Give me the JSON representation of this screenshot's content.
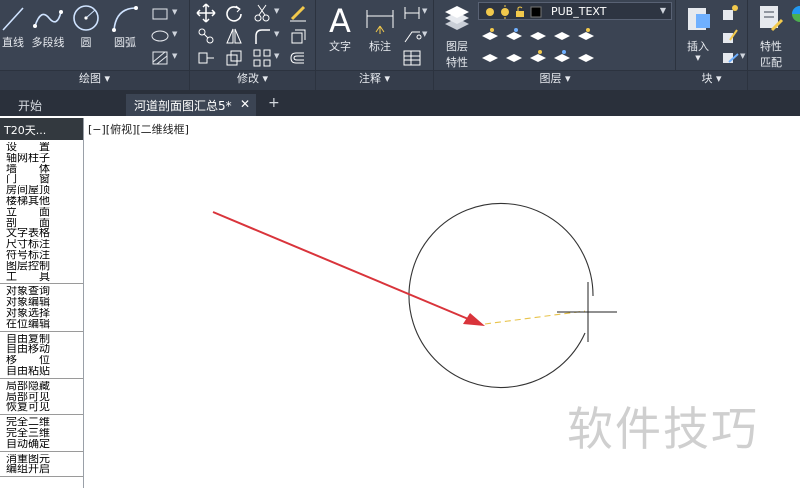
{
  "ribbon": {
    "draw": {
      "title": "绘图",
      "line_label": "直线",
      "polyline_label": "多段线",
      "circle_label": "圆",
      "arc_label": "圆弧"
    },
    "modify": {
      "title": "修改"
    },
    "annotation": {
      "title": "注释",
      "text_label": "文字",
      "dim_label": "标注"
    },
    "layers": {
      "title": "图层",
      "props_label_1": "图层",
      "props_label_2": "特性",
      "current_layer": "PUB_TEXT"
    },
    "block": {
      "title": "块",
      "insert_label": "插入"
    },
    "properties": {
      "label_1": "特性",
      "label_2": "匹配"
    }
  },
  "tabs": {
    "start": "开始",
    "drawing": "河道剖面图汇总5*",
    "close": "✕",
    "add": "+"
  },
  "palette": {
    "title": "T20天...",
    "groups": [
      [
        "设　　置",
        "轴网柱子",
        "墙　　体",
        "门　　窗",
        "房间屋顶",
        "楼梯其他",
        "立　　面",
        "剖　　面",
        "文字表格",
        "尺寸标注",
        "符号标注",
        "图层控制",
        "工　　具"
      ],
      [
        "对象查询",
        "对象编辑",
        "对象选择",
        "在位编辑"
      ],
      [
        "自由复制",
        "自由移动",
        "移　　位",
        "自由粘贴"
      ],
      [
        "局部隐藏",
        "局部可见",
        "恢复可见"
      ],
      [
        "完全二维",
        "完全三维",
        "自动确定"
      ],
      [
        "消重图元",
        "编组开启"
      ]
    ]
  },
  "canvas": {
    "viewport_label": "[−][俯视][二维线框]",
    "watermark": "软件技巧"
  },
  "colors": {
    "ribbon_bg": "#3b4453",
    "tab_bar_bg": "#2a303b",
    "arrow": "#d9343b",
    "dashed_line": "#e8c34a"
  }
}
